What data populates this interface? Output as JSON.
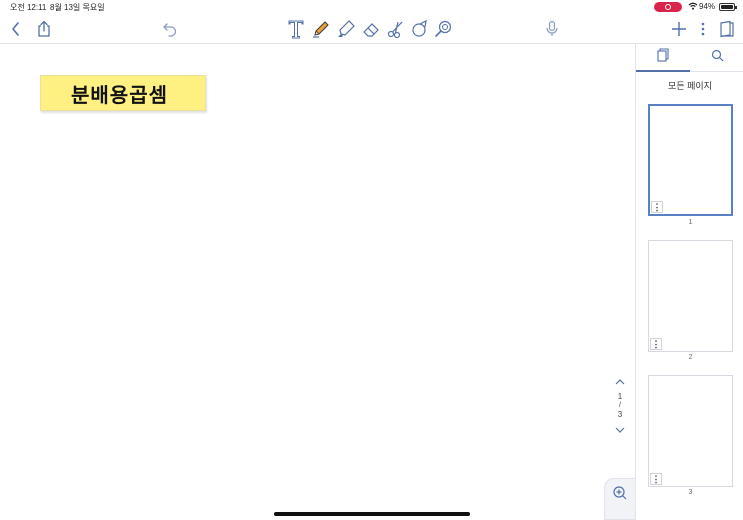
{
  "status_bar": {
    "time": "오전 12:11",
    "date": "8월 13일 목요일",
    "battery": "94%",
    "battery_level": 0.94,
    "recording_color": "#d9254c"
  },
  "toolbar": {
    "left": [
      {
        "name": "back-chevron-icon"
      },
      {
        "name": "share-icon"
      },
      {
        "name": "undo-icon"
      }
    ],
    "tools": [
      {
        "name": "text-tool-icon"
      },
      {
        "name": "pen-tool-icon",
        "active": true,
        "color": "#e8a23a"
      },
      {
        "name": "highlighter-tool-icon"
      },
      {
        "name": "eraser-tool-icon"
      },
      {
        "name": "lasso-scissors-icon"
      },
      {
        "name": "shapes-tool-icon"
      },
      {
        "name": "laser-pointer-icon"
      }
    ],
    "right": [
      {
        "name": "microphone-icon"
      },
      {
        "name": "add-page-icon"
      },
      {
        "name": "more-vertical-icon"
      },
      {
        "name": "document-outline-icon"
      }
    ],
    "accent_color": "#5470a8"
  },
  "canvas": {
    "title_sticker": "분배용곱셈",
    "sticker_color": "#fff082",
    "pager": {
      "current": "1",
      "separator": "/",
      "total": "3"
    }
  },
  "sidebar": {
    "tabs": [
      {
        "name": "pages-tab",
        "icon": "page-icon",
        "active": true
      },
      {
        "name": "search-tab",
        "icon": "search-icon",
        "active": false
      }
    ],
    "heading": "모든 페이지",
    "pages": [
      {
        "label": "1",
        "selected": true
      },
      {
        "label": "2",
        "selected": false
      },
      {
        "label": "3",
        "selected": false
      }
    ]
  }
}
